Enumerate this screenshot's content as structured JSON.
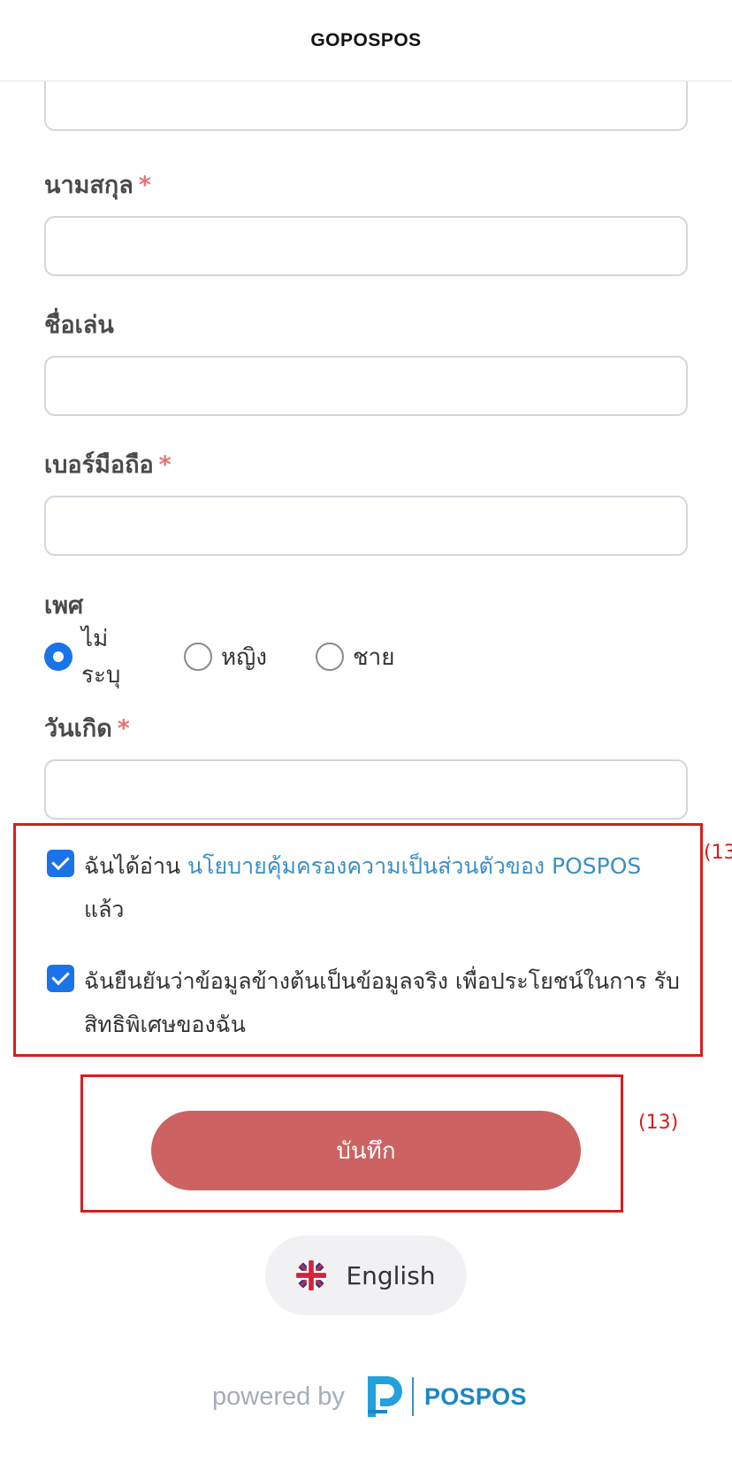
{
  "header": {
    "title": "GOPOSPOS"
  },
  "form": {
    "lastname": {
      "label": "นามสกุล",
      "required": "*",
      "value": ""
    },
    "nickname": {
      "label": "ชื่อเล่น",
      "value": ""
    },
    "phone": {
      "label": "เบอร์มือถือ",
      "required": "*",
      "value": ""
    },
    "gender": {
      "label": "เพศ",
      "options": [
        "ไม่ระบุ",
        "หญิง",
        "ชาย"
      ],
      "selected": "ไม่ระบุ"
    },
    "birthday": {
      "label": "วันเกิด",
      "required": "*",
      "value": ""
    }
  },
  "consents": [
    {
      "checked": true,
      "text_before": "ฉันได้อ่าน",
      "link_text": "นโยบายคุ้มครองความเป็นส่วนตัวของ POSPOS",
      "text_after": "แล้ว"
    },
    {
      "checked": true,
      "text": "ฉันยืนยันว่าข้อมูลข้างต้นเป็นข้อมูลจริง เพื่อประโยชน์ในการ รับสิทธิพิเศษของฉัน"
    }
  ],
  "annotations": {
    "consent": "(13",
    "save": "(13)"
  },
  "save_button": {
    "label": "บันทึก"
  },
  "language_button": {
    "label": "English"
  },
  "footer": {
    "powered_by": "powered by",
    "brand": "POSPOS"
  },
  "colors": {
    "primary": "#1a73e8",
    "save_button": "#cd6262",
    "link": "#3b8fc4",
    "required": "#e57373",
    "annotation": "#d51e1e"
  }
}
